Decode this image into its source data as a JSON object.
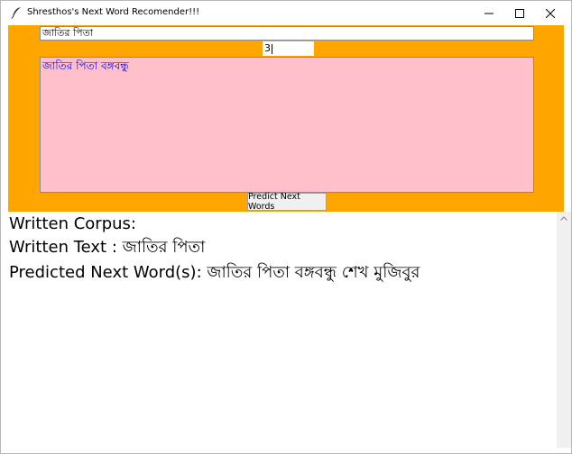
{
  "window": {
    "title": "Shresthos's Next Word Recomender!!!",
    "icon": "feather-icon",
    "controls": [
      "minimize-icon",
      "maximize-icon",
      "close-icon"
    ]
  },
  "input": {
    "text_value": "জাতির পিতা",
    "count_value": "3"
  },
  "result_box": {
    "text": "জাতির পিতা বঙ্গবন্ধু"
  },
  "predict_button": {
    "label": "Predict Next Words"
  },
  "output": {
    "corpus_line": "Written Corpus:",
    "written_line": "Written Text : জাতির পিতা",
    "predicted_line": "Predicted Next Word(s): জাতির পিতা  বঙ্গবন্ধু শেখ মুজিবুর"
  },
  "colors": {
    "panel": "#ffa500",
    "result_bg": "#ffc0cb",
    "result_text": "#0000ff"
  }
}
